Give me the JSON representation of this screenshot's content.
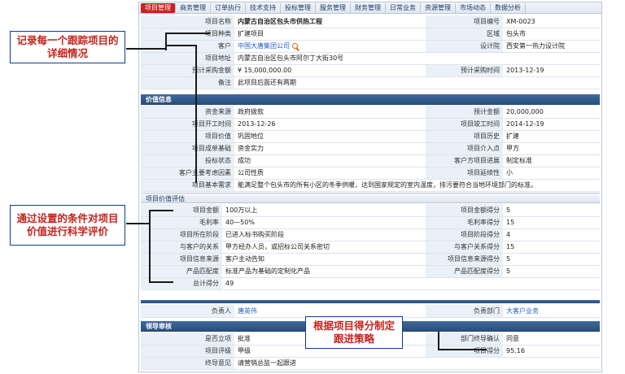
{
  "nav": {
    "items": [
      "项目管理",
      "商务管理",
      "订单执行",
      "技术支持",
      "投标管理",
      "服务管理",
      "财务管理",
      "日常业务",
      "资源管理",
      "市场动态",
      "数据分析"
    ]
  },
  "project": {
    "name_label": "项目名称",
    "name_value": "内蒙古自治区包头市供热工程",
    "code_label": "项目编号",
    "code_value": "XM-0023",
    "type_label": "项目种类",
    "type_value": "扩建项目",
    "region_label": "区域",
    "region_value": "包头市",
    "client_label": "客户",
    "client_value": "中国大唐集团公司",
    "designer_label": "设计院",
    "designer_value": "西安第一热力设计院",
    "address_label": "项目地址",
    "address_value": "内蒙古自治区包头市阿尔丁大街30号",
    "budget_label": "预计采购金额",
    "budget_value": "¥ 15,000,000.00",
    "purchase_time_label": "预计采购时间",
    "purchase_time_value": "2013-12-19",
    "remark_label": "备注",
    "remark_value": "此项目后面还有两期"
  },
  "value_info": {
    "header": "价值信息",
    "fund_source_label": "资金来源",
    "fund_source_value": "政府拨款",
    "est_amount_label": "预计金额",
    "est_amount_value": "20,000,000",
    "start_time_label": "项目开工时间",
    "start_time_value": "2013-12-26",
    "end_time_label": "项目竣工时间",
    "end_time_value": "2014-12-19",
    "value_label": "项目价值",
    "value_value": "巩固地位",
    "history_label": "项目历史",
    "history_value": "扩建",
    "success_label": "项目成单基础",
    "success_value": "资金实力",
    "entry_label": "项目介入点",
    "entry_value": "甲方",
    "bid_status_label": "投标状态",
    "bid_status_value": "成功",
    "progress_label": "客户方项目进展",
    "progress_value": "制定标准",
    "factor_label": "客户主要考虑因素",
    "factor_value": "公司性质",
    "delay_label": "项目延续性",
    "delay_value": "小",
    "basic_need_label": "项目基本需求",
    "basic_need_value": "能满足整个包头市的所有小区的冬季供暖，达到国家规定的室内温度，排污要符合当地环境部门的标准。"
  },
  "evaluation": {
    "header": "项目价值评估",
    "rows": [
      {
        "label": "项目金额",
        "value": "100万以上",
        "score_label": "项目金额得分",
        "score": "5"
      },
      {
        "label": "毛利率",
        "value": "40—50%",
        "score_label": "毛利率得分",
        "score": "15"
      },
      {
        "label": "项目所在阶段",
        "value": "已进入标书购买阶段",
        "score_label": "项目阶段得分",
        "score": "4"
      },
      {
        "label": "与客户的关系",
        "value": "甲方经办人员，或招标公司关系密切",
        "score_label": "与客户关系得分",
        "score": "15"
      },
      {
        "label": "项目信息来源",
        "value": "客户主动告知",
        "score_label": "项目信息来源得分",
        "score": "5"
      },
      {
        "label": "产品匹配度",
        "value": "标准产品为基础的定制化产品",
        "score_label": "产品匹配度得分",
        "score": "5"
      }
    ],
    "total_label": "总计得分",
    "total_value": "49"
  },
  "owner": {
    "owner_label": "负责人",
    "owner_value": "唐英伟",
    "dept_label": "负责部门",
    "dept_value": "大客户业务"
  },
  "review": {
    "header": "领导审核",
    "approved_label": "是否立项",
    "approved_value": "批准",
    "dept_confirm_label": "部门终导确认",
    "dept_confirm_value": "同意",
    "level_label": "项目评级",
    "level_value": "甲级",
    "score_label": "项目得分",
    "score_value": "95.16",
    "opinion_label": "终导意见",
    "opinion_value": "请营销总监一起跟进"
  },
  "callouts": {
    "record": "记录每一个跟踪项目的详细情况",
    "evaluate": "通过设置的条件对项目价值进行科学评价",
    "strategy": "根据项目得分制定跟进策略"
  },
  "colors": {
    "accent": "#c8221c",
    "header_blue": "#274b78",
    "label_bg": "#eaf0f7",
    "link": "#1b5fc7"
  }
}
